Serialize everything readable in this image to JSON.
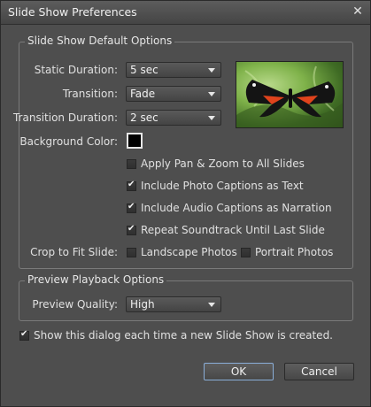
{
  "window": {
    "title": "Slide Show Preferences"
  },
  "default_options": {
    "legend": "Slide Show Default Options",
    "static_duration": {
      "label": "Static Duration:",
      "value": "5 sec"
    },
    "transition": {
      "label": "Transition:",
      "value": "Fade"
    },
    "transition_duration": {
      "label": "Transition Duration:",
      "value": "2 sec"
    },
    "background_color": {
      "label": "Background Color:",
      "color": "#000000"
    },
    "checkboxes": [
      {
        "label": "Apply Pan & Zoom to All Slides",
        "checked": false
      },
      {
        "label": "Include Photo Captions as Text",
        "checked": true
      },
      {
        "label": "Include Audio Captions as Narration",
        "checked": true
      },
      {
        "label": "Repeat Soundtrack Until Last Slide",
        "checked": true
      }
    ],
    "crop_to_fit": {
      "label": "Crop to Fit Slide:",
      "landscape": {
        "label": "Landscape Photos",
        "checked": false
      },
      "portrait": {
        "label": "Portrait Photos",
        "checked": false
      }
    },
    "preview_image": "butterfly-photo"
  },
  "preview_playback": {
    "legend": "Preview Playback Options",
    "quality": {
      "label": "Preview Quality:",
      "value": "High"
    }
  },
  "show_dialog": {
    "label": "Show this dialog each time a new Slide Show is created.",
    "checked": true
  },
  "buttons": {
    "ok": "OK",
    "cancel": "Cancel"
  },
  "colors": {
    "dialog_bg": "#4e4e4e",
    "default_button_border": "#8aaed8"
  }
}
